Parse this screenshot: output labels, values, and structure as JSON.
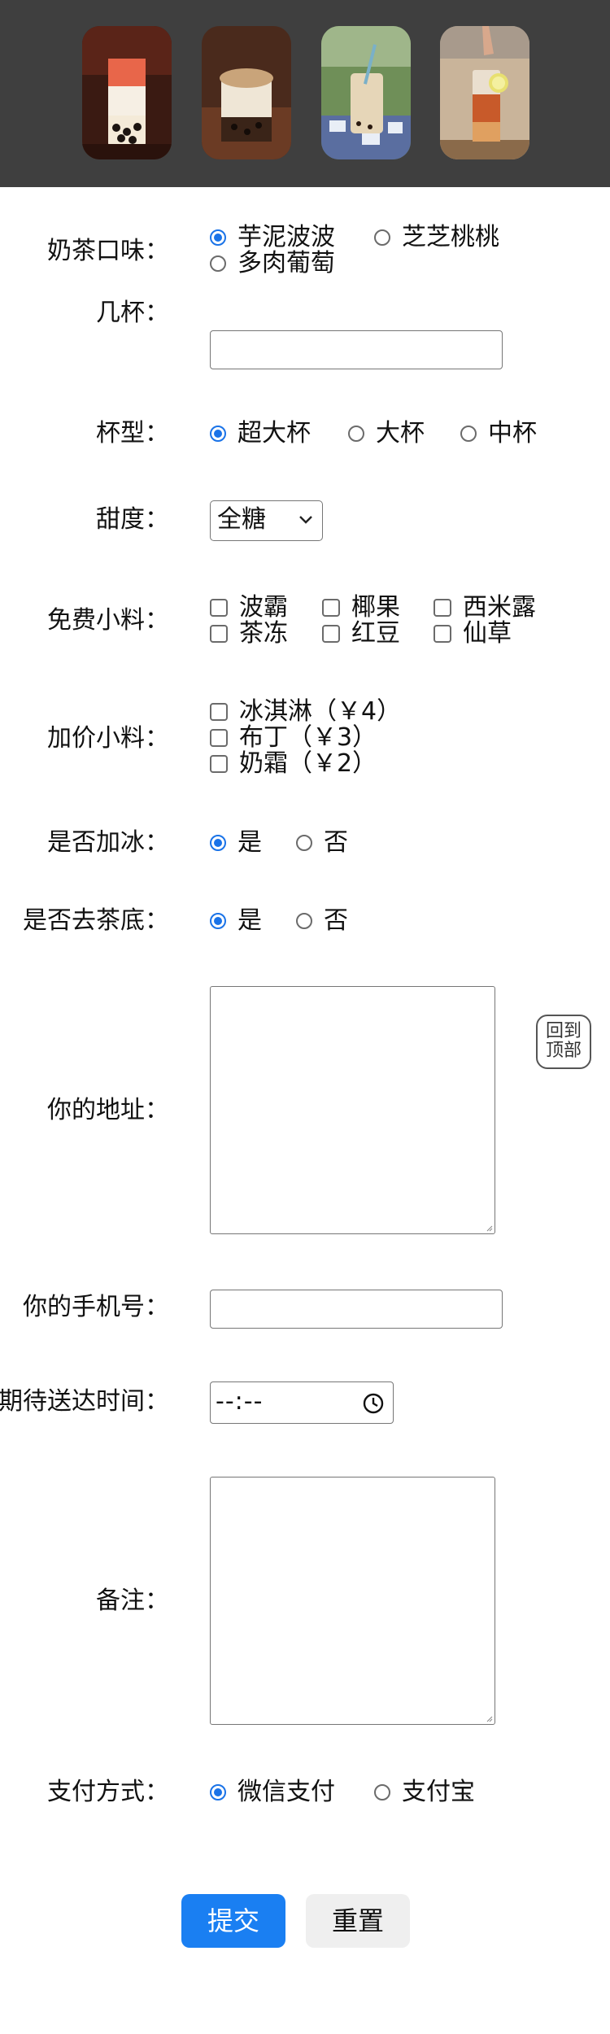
{
  "header": {
    "images": [
      {
        "name": "bubble-tea-strawberry-image"
      },
      {
        "name": "bubble-tea-taro-image"
      },
      {
        "name": "bubble-tea-outdoor-image"
      },
      {
        "name": "bubble-tea-lemon-image"
      }
    ]
  },
  "form": {
    "flavor": {
      "label": "奶茶口味：",
      "options": [
        "芋泥波波",
        "芝芝桃桃",
        "多肉葡萄"
      ],
      "selected": "芋泥波波"
    },
    "cups": {
      "label": "几杯：",
      "value": ""
    },
    "size": {
      "label": "杯型：",
      "options": [
        "超大杯",
        "大杯",
        "中杯"
      ],
      "selected": "超大杯"
    },
    "sweetness": {
      "label": "甜度：",
      "value": "全糖"
    },
    "free_toppings": {
      "label": "免费小料：",
      "options": [
        "波霸",
        "椰果",
        "西米露",
        "茶冻",
        "红豆",
        "仙草"
      ]
    },
    "paid_toppings": {
      "label": "加价小料：",
      "options": [
        "冰淇淋（￥4）",
        "布丁（￥3）",
        "奶霜（￥2）"
      ]
    },
    "ice": {
      "label": "是否加冰：",
      "options": [
        "是",
        "否"
      ],
      "selected": "是"
    },
    "tea_base": {
      "label": "是否去茶底：",
      "options": [
        "是",
        "否"
      ],
      "selected": "是"
    },
    "address": {
      "label": "你的地址：",
      "value": ""
    },
    "phone": {
      "label": "你的手机号：",
      "value": ""
    },
    "delivery_time": {
      "label": "期待送达时间：",
      "value": "--:--"
    },
    "notes": {
      "label": "备注：",
      "value": ""
    },
    "payment": {
      "label": "支付方式：",
      "options": [
        "微信支付",
        "支付宝"
      ],
      "selected": "微信支付"
    }
  },
  "back_to_top": {
    "line1": "回到",
    "line2": "顶部"
  },
  "buttons": {
    "submit": "提交",
    "reset": "重置"
  },
  "colors": {
    "header_bg": "#3f3f3f",
    "accent": "#1a73e8",
    "submit_bg": "#1a7ff2",
    "reset_bg": "#efefef"
  }
}
